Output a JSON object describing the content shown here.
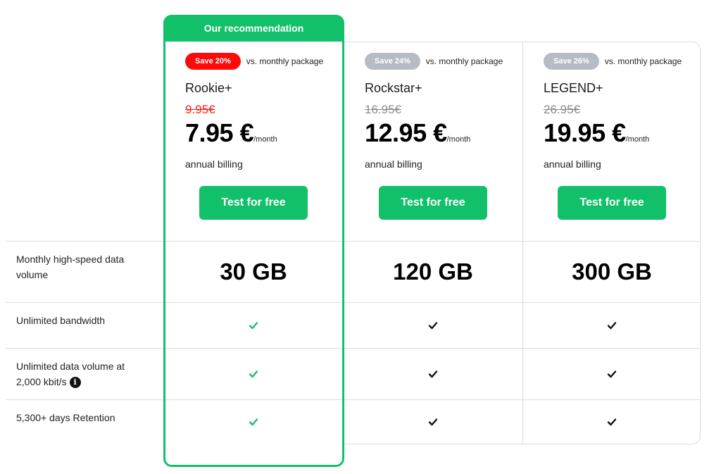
{
  "recommendation_banner": "Our recommendation",
  "vs_text": "vs. monthly package",
  "plans": [
    {
      "name": "Rookie+",
      "save": "Save 20%",
      "old_price": "9.95€",
      "price": "7.95 €",
      "per": "/month",
      "billing": "annual billing",
      "cta": "Test for free",
      "data_volume": "30 GB",
      "badge_color": "#ff0a0a",
      "check_color": "#13c06a"
    },
    {
      "name": "Rockstar+",
      "save": "Save 24%",
      "old_price": "16.95€",
      "price": "12.95 €",
      "per": "/month",
      "billing": "annual billing",
      "cta": "Test for free",
      "data_volume": "120 GB",
      "badge_color": "#b6bcc3",
      "check_color": "#111111"
    },
    {
      "name": "LEGEND+",
      "save": "Save 26%",
      "old_price": "26.95€",
      "price": "19.95 €",
      "per": "/month",
      "billing": "annual billing",
      "cta": "Test for free",
      "data_volume": "300 GB",
      "badge_color": "#b6bcc3",
      "check_color": "#111111"
    }
  ],
  "features": [
    {
      "label": "Monthly high-speed data volume"
    },
    {
      "label": "Unlimited bandwidth",
      "included": [
        true,
        true,
        true
      ]
    },
    {
      "label": "Unlimited data volume at 2,000 kbit/s",
      "info_icon": "info-icon",
      "info_glyph": "i",
      "included": [
        true,
        true,
        true
      ]
    },
    {
      "label": "5,300+ days Retention",
      "included": [
        true,
        true,
        true
      ]
    }
  ],
  "colors": {
    "accent": "#13c06a",
    "sale_red": "#ff0a0a",
    "border": "#dcdcdc"
  }
}
